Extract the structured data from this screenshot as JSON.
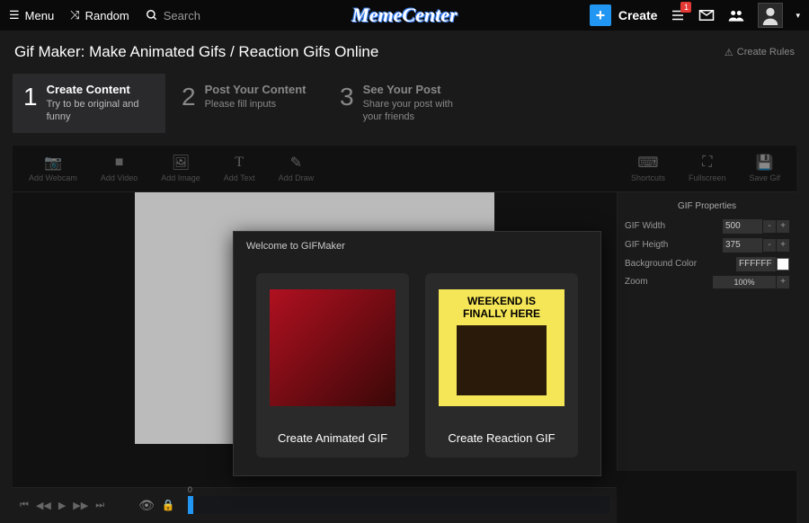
{
  "topbar": {
    "menu": "Menu",
    "random": "Random",
    "search_placeholder": "Search",
    "logo": "MemeCenter",
    "create": "Create",
    "notification_count": "1"
  },
  "title": "Gif Maker: Make Animated Gifs / Reaction Gifs Online",
  "rules_label": "Create Rules",
  "steps": [
    {
      "num": "1",
      "title": "Create Content",
      "sub": "Try to be original and funny"
    },
    {
      "num": "2",
      "title": "Post Your Content",
      "sub": "Please fill inputs"
    },
    {
      "num": "3",
      "title": "See Your Post",
      "sub": "Share your post with your friends"
    }
  ],
  "tools": {
    "left": [
      {
        "name": "add-webcam",
        "label": "Add Webcam"
      },
      {
        "name": "add-video",
        "label": "Add Video"
      },
      {
        "name": "add-image",
        "label": "Add Image"
      },
      {
        "name": "add-text",
        "label": "Add Text"
      },
      {
        "name": "add-draw",
        "label": "Add Draw"
      }
    ],
    "right": [
      {
        "name": "shortcuts",
        "label": "Shortcuts"
      },
      {
        "name": "fullscreen",
        "label": "Fullscreen"
      },
      {
        "name": "save-gif",
        "label": "Save Gif"
      }
    ]
  },
  "panel": {
    "title": "GIF Properties",
    "width_label": "GIF Width",
    "width_value": "500",
    "height_label": "GIF Heigth",
    "height_value": "375",
    "bg_label": "Background Color",
    "bg_value": "FFFFFF",
    "zoom_label": "Zoom",
    "zoom_value": "100%"
  },
  "timeline": {
    "start": "0"
  },
  "modal": {
    "title": "Welcome to GIFMaker",
    "animated_label": "Create Animated GIF",
    "reaction_label": "Create Reaction GIF",
    "reaction_text1": "WEEKEND IS",
    "reaction_text2": "FINALLY HERE"
  }
}
